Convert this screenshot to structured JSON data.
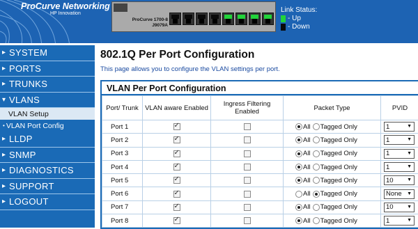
{
  "header": {
    "brand": "ProCurve Networking",
    "brand_sub": "HP Innovation",
    "switch_model_line1": "ProCurve 1700-8",
    "switch_model_line2": "J9079A",
    "switch_ports": [
      {
        "status": "down"
      },
      {
        "status": "down"
      },
      {
        "status": "down"
      },
      {
        "status": "down"
      },
      {
        "status": "up"
      },
      {
        "status": "up"
      },
      {
        "status": "up"
      },
      {
        "status": "up"
      }
    ],
    "link_status_label": "Link Status:",
    "legend_up": "- Up",
    "legend_down": "- Down",
    "colors": {
      "up": "#22d33a",
      "down": "#0a0a0a",
      "header_bg": "#1d63b3"
    }
  },
  "sidebar": {
    "items_top": [
      {
        "label": "SYSTEM",
        "arrow": "▸"
      },
      {
        "label": "PORTS",
        "arrow": "▸"
      },
      {
        "label": "TRUNKS",
        "arrow": "▸"
      },
      {
        "label": "VLANS",
        "arrow": "▾"
      }
    ],
    "sub_items": [
      {
        "label": "VLAN Setup"
      },
      {
        "label": "VLAN Port Config"
      }
    ],
    "items_bottom": [
      {
        "label": "LLDP",
        "arrow": "▸"
      },
      {
        "label": "SNMP",
        "arrow": "▸"
      },
      {
        "label": "DIAGNOSTICS",
        "arrow": "▸"
      },
      {
        "label": "SUPPORT",
        "arrow": "▸"
      },
      {
        "label": "LOGOUT",
        "arrow": "▸"
      }
    ]
  },
  "main": {
    "title": "802.1Q Per Port Configuration",
    "description": "This page allows you to configure the VLAN settings per port.",
    "panel_title": "VLAN Per Port Configuration",
    "columns": {
      "port": "Port/ Trunk",
      "vlan_aware": "VLAN aware Enabled",
      "ingress": "Ingress Filtering Enabled",
      "packet_type": "Packet Type",
      "pvid": "PVID"
    },
    "radio_all": "All",
    "radio_tagged": "Tagged Only",
    "rows": [
      {
        "port": "Port 1",
        "vlan_aware": true,
        "ingress": false,
        "packet": "all",
        "pvid": "1"
      },
      {
        "port": "Port 2",
        "vlan_aware": true,
        "ingress": false,
        "packet": "all",
        "pvid": "1"
      },
      {
        "port": "Port 3",
        "vlan_aware": true,
        "ingress": false,
        "packet": "all",
        "pvid": "1"
      },
      {
        "port": "Port 4",
        "vlan_aware": true,
        "ingress": false,
        "packet": "all",
        "pvid": "1"
      },
      {
        "port": "Port 5",
        "vlan_aware": true,
        "ingress": false,
        "packet": "all",
        "pvid": "10"
      },
      {
        "port": "Port 6",
        "vlan_aware": true,
        "ingress": false,
        "packet": "tagged",
        "pvid": "None"
      },
      {
        "port": "Port 7",
        "vlan_aware": true,
        "ingress": false,
        "packet": "all",
        "pvid": "10"
      },
      {
        "port": "Port 8",
        "vlan_aware": true,
        "ingress": false,
        "packet": "all",
        "pvid": "1"
      }
    ]
  }
}
